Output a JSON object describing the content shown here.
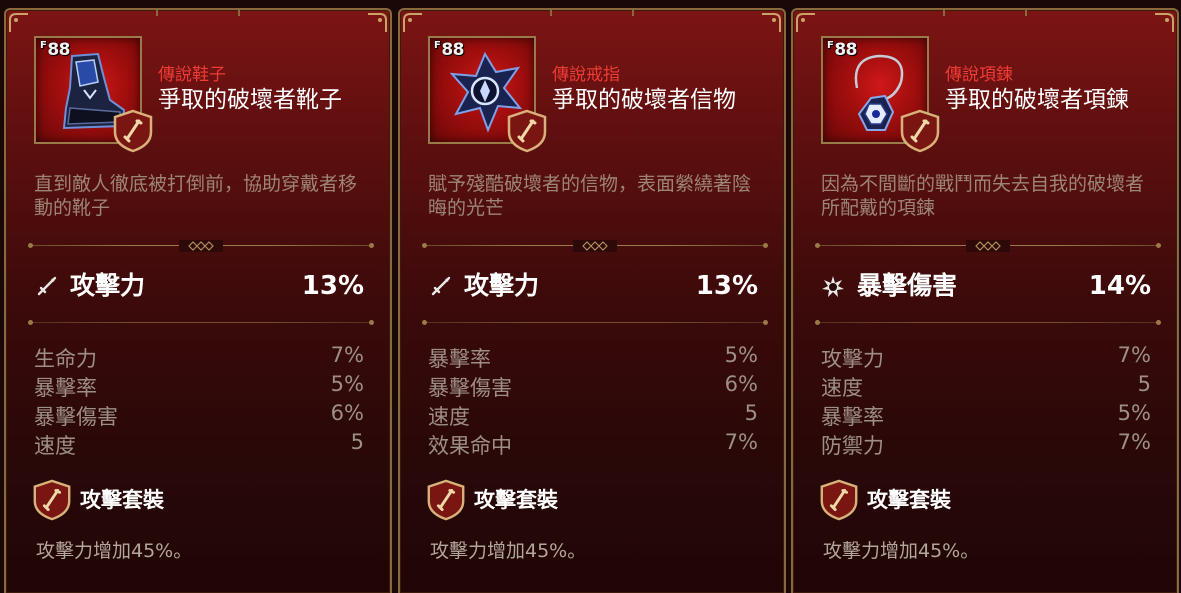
{
  "cards": [
    {
      "level": "88",
      "rarity": "傳說鞋子",
      "name": "爭取的破壞者靴子",
      "description": "直到敵人徹底被打倒前，協助穿戴者移動的靴子",
      "main_stat": {
        "label": "攻擊力",
        "value": "13%",
        "icon": "sword-icon"
      },
      "sub_stats": [
        {
          "label": "生命力",
          "value": "7%"
        },
        {
          "label": "暴擊率",
          "value": "5%"
        },
        {
          "label": "暴擊傷害",
          "value": "6%"
        },
        {
          "label": "速度",
          "value": "5"
        }
      ],
      "set_name": "攻擊套裝",
      "set_effect": "攻擊力增加45%。",
      "item_icon": "boots-icon"
    },
    {
      "level": "88",
      "rarity": "傳說戒指",
      "name": "爭取的破壞者信物",
      "description": "賦予殘酷破壞者的信物，表面縈繞著陰晦的光芒",
      "main_stat": {
        "label": "攻擊力",
        "value": "13%",
        "icon": "sword-icon"
      },
      "sub_stats": [
        {
          "label": "暴擊率",
          "value": "5%"
        },
        {
          "label": "暴擊傷害",
          "value": "6%"
        },
        {
          "label": "速度",
          "value": "5"
        },
        {
          "label": "效果命中",
          "value": "7%"
        }
      ],
      "set_name": "攻擊套裝",
      "set_effect": "攻擊力增加45%。",
      "item_icon": "ring-icon"
    },
    {
      "level": "88",
      "rarity": "傳說項鍊",
      "name": "爭取的破壞者項鍊",
      "description": "因為不間斷的戰鬥而失去自我的破壞者所配戴的項鍊",
      "main_stat": {
        "label": "暴擊傷害",
        "value": "14%",
        "icon": "crit-burst-icon"
      },
      "sub_stats": [
        {
          "label": "攻擊力",
          "value": "7%"
        },
        {
          "label": "速度",
          "value": "5"
        },
        {
          "label": "暴擊率",
          "value": "5%"
        },
        {
          "label": "防禦力",
          "value": "7%"
        }
      ],
      "set_name": "攻擊套裝",
      "set_effect": "攻擊力增加45%。",
      "item_icon": "necklace-icon"
    }
  ],
  "colors": {
    "rarity_legendary": "#f03c34",
    "card_bg_top": "#7c1414",
    "card_border": "#8a6a3c",
    "description_text": "#9d8574",
    "sub_stat_text": "#9e8f86"
  }
}
